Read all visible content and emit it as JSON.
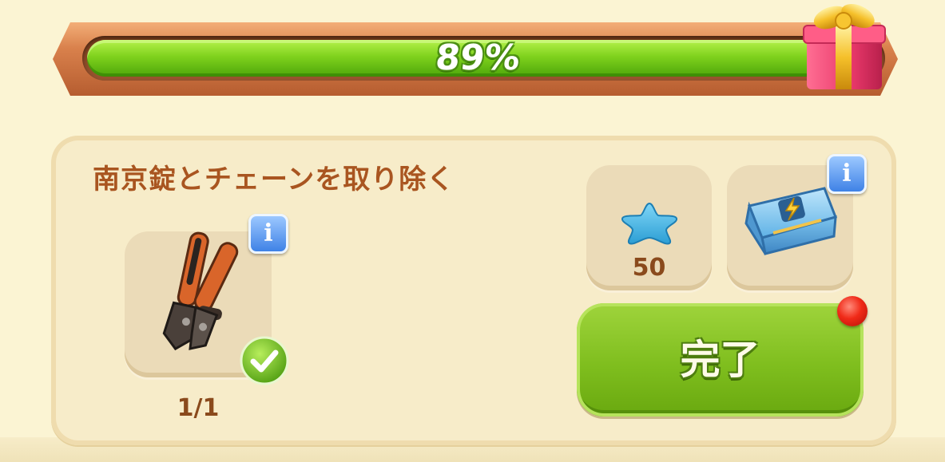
{
  "progress": {
    "value_percent": 89,
    "label": "89%",
    "fill_color": "#7fd21d"
  },
  "icons": {
    "gift": "gift-box-icon",
    "tool": "bolt-cutter-icon",
    "check": "check-badge-icon",
    "star": "blue-star-icon",
    "chest": "energy-chest-icon",
    "notification": "red-notification-dot"
  },
  "task": {
    "title": "南京錠とチェーンを取り除く",
    "tool_progress": "1/1",
    "info_label": "i"
  },
  "rewards": {
    "star_amount": "50",
    "info_label": "i"
  },
  "complete_button": {
    "label": "完了"
  }
}
